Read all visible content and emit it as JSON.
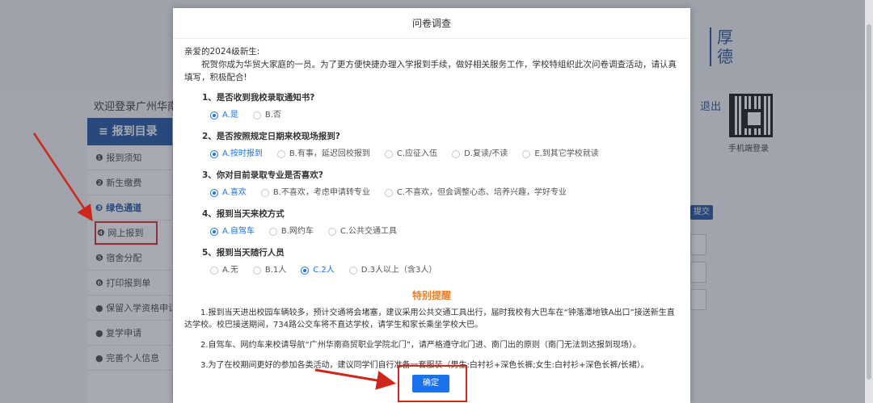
{
  "background": {
    "motto": "厚德",
    "welcome": "欢迎登录广州华南",
    "logout": "退出",
    "qr_label": "手机端登录",
    "submit_chip": "提交",
    "sidebar": {
      "header": "≡ 报到目录",
      "items": [
        {
          "label": "❶ 报到须知"
        },
        {
          "label": "❷ 新生缴费"
        },
        {
          "label": "❸ 绿色通道"
        },
        {
          "label": "❹ 网上报到"
        },
        {
          "label": "❺ 宿舍分配"
        },
        {
          "label": "❻ 打印报到单"
        },
        {
          "label": "● 保留入学资格申请"
        },
        {
          "label": "● 复学申请"
        },
        {
          "label": "● 完善个人信息"
        }
      ]
    }
  },
  "modal": {
    "title": "问卷调查",
    "greeting": "亲爱的2024级新生:",
    "intro": "祝贺你成为华贸大家庭的一员。为了更方便快捷办理入学报到手续，做好相关服务工作，学校特组织此次问卷调查活动，请认真填写，积极配合!",
    "questions": [
      {
        "title": "1、是否收到我校录取通知书?",
        "options": [
          "A.是",
          "B.否"
        ],
        "selected": 0
      },
      {
        "title": "2、是否按照规定日期来校现场报到?",
        "options": [
          "A.按时报到",
          "B.有事，延迟回校报到",
          "C.应征入伍",
          "D.复读/不读",
          "E.到其它学校就读"
        ],
        "selected": 0
      },
      {
        "title": "3、你对目前录取专业是否喜欢?",
        "options": [
          "A.喜欢",
          "B.不喜欢，考虑申请转专业",
          "C.不喜欢，但会调整心态、培养兴趣，学好专业"
        ],
        "selected": 0
      },
      {
        "title": "4、报到当天来校方式",
        "options": [
          "A.自驾车",
          "B.网约车",
          "C.公共交通工具"
        ],
        "selected": 0
      },
      {
        "title": "5、报到当天随行人员",
        "options": [
          "A.无",
          "B.1人",
          "C.2人",
          "D.3人以上（含3人）"
        ],
        "selected": 2
      }
    ],
    "notice_title": "特别提醒",
    "notes": [
      "1.报到当天进出校园车辆较多，预计交通将会堵塞，建议采用公共交通工具出行，届时我校有大巴车在“钟落潭地铁A出口”接送新生直达学校。校巴接送期间，734路公交车将不直达学校，请学生和家长乘坐学校大巴。",
      "2.自驾车、网约车来校请导航“广州华南商贸职业学院北门”，请严格遵守北门进、南门出的原则（南门无法到达报到现场）。",
      "3.为了在校期间更好的参加各类活动，建议同学们自行准备一套服装（男生:白衬衫+深色长裤;女生:白衬衫+深色长裤/长裙）。"
    ],
    "confirm_label": "确定"
  },
  "colors": {
    "accent": "#1a73e8",
    "sidebar_blue": "#1a4fa0",
    "highlight_red": "#d0271c",
    "notice_orange": "#e8802a"
  }
}
